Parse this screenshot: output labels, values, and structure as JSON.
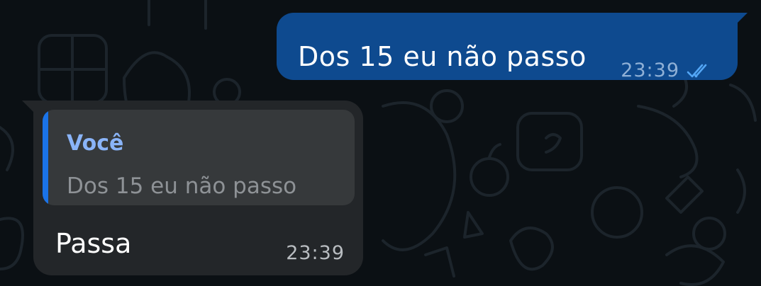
{
  "messages": [
    {
      "direction": "outgoing",
      "text": "Dos 15 eu não passo",
      "time": "23:39",
      "status": "read",
      "status_icon": "double-check-icon",
      "bubble_color": "#0e4a8f",
      "tick_color": "#53a6f5"
    },
    {
      "direction": "incoming",
      "reply_to": {
        "author": "Você",
        "text": "Dos 15 eu não passo",
        "accent_color": "#1a73e8",
        "author_color": "#8ab4f8"
      },
      "text": "Passa",
      "time": "23:39",
      "bubble_color": "#232629"
    }
  ],
  "theme": {
    "background": "#0b1014",
    "doodle_color": "#1c242b"
  }
}
